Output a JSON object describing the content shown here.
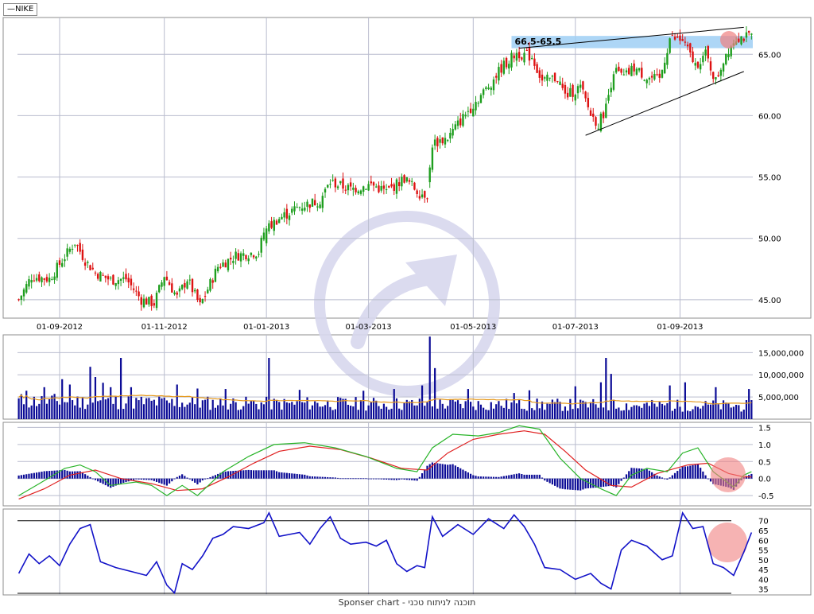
{
  "legend": {
    "symbol": "NIKE"
  },
  "footer": {
    "text": "Sponser chart - תוכנה לניתוח טכני"
  },
  "colors": {
    "up": "#1e9e1e",
    "down": "#dd1111",
    "volume": "#0b0b96",
    "volume_ma": "#e69a1e",
    "macd_fast": "#28b428",
    "macd_signal": "#e02020",
    "rsi": "#1212c8",
    "zone": "#9fcff5",
    "highlight": "#f08080",
    "grid": "#b9bcce",
    "watermark": "#d8d8ee"
  },
  "chart_data": {
    "type": "candlestick",
    "price": {
      "ylim": [
        43.5,
        68
      ],
      "ticks": [
        "45.00",
        "50.00",
        "55.00",
        "60.00",
        "65.00"
      ],
      "tick_values": [
        45,
        50,
        55,
        60,
        65
      ],
      "x_labels": [
        "01-09-2012",
        "01-11-2012",
        "01-01-2013",
        "01-03-2013",
        "01-05-2013",
        "01-07-2013",
        "01-09-2013"
      ],
      "x_label_index": [
        16,
        57,
        97,
        137,
        178,
        218,
        259
      ],
      "anchors": [
        [
          0,
          45.0
        ],
        [
          5,
          46.9
        ],
        [
          12,
          46.7
        ],
        [
          18,
          48.5
        ],
        [
          22,
          49.7
        ],
        [
          26,
          48.2
        ],
        [
          30,
          47.2
        ],
        [
          36,
          46.6
        ],
        [
          42,
          46.7
        ],
        [
          48,
          45.0
        ],
        [
          53,
          44.7
        ],
        [
          57,
          47.0
        ],
        [
          62,
          45.2
        ],
        [
          66,
          46.7
        ],
        [
          71,
          44.5
        ],
        [
          78,
          47.7
        ],
        [
          85,
          48.6
        ],
        [
          94,
          48.9
        ],
        [
          96,
          50.5
        ],
        [
          101,
          51.5
        ],
        [
          110,
          52.6
        ],
        [
          118,
          53.1
        ],
        [
          122,
          54.6
        ],
        [
          130,
          54.0
        ],
        [
          138,
          54.4
        ],
        [
          144,
          53.8
        ],
        [
          151,
          54.9
        ],
        [
          157,
          53.7
        ],
        [
          160,
          53.6
        ],
        [
          162,
          57.7
        ],
        [
          168,
          58.2
        ],
        [
          176,
          60.4
        ],
        [
          184,
          62.4
        ],
        [
          189,
          63.9
        ],
        [
          195,
          65.1
        ],
        [
          201,
          64.8
        ],
        [
          205,
          62.8
        ],
        [
          211,
          63.1
        ],
        [
          214,
          61.6
        ],
        [
          220,
          62.3
        ],
        [
          224,
          60.1
        ],
        [
          227,
          59.3
        ],
        [
          230,
          60.7
        ],
        [
          233,
          63.7
        ],
        [
          237,
          63.1
        ],
        [
          241,
          63.9
        ],
        [
          246,
          63.1
        ],
        [
          251,
          62.9
        ],
        [
          255,
          66.3
        ],
        [
          260,
          66.1
        ],
        [
          265,
          64.1
        ],
        [
          269,
          65.0
        ],
        [
          273,
          62.8
        ],
        [
          277,
          65.1
        ],
        [
          281,
          66.4
        ]
      ],
      "zone": {
        "label": "66.5-65.5",
        "low": 65.5,
        "high": 66.5
      },
      "trendlines": [
        {
          "from": [
            196,
            65.5
          ],
          "to": [
            284,
            67.2
          ]
        },
        {
          "from": [
            222,
            58.4
          ],
          "to": [
            284,
            63.6
          ]
        }
      ]
    },
    "volume": {
      "ylim": [
        0,
        19000000
      ],
      "ticks": [
        "5,000,000",
        "10,000,000",
        "15,000,000"
      ],
      "tick_values": [
        5000000,
        10000000,
        15000000
      ],
      "spikes": [
        [
          3,
          6400000
        ],
        [
          10,
          7200000
        ],
        [
          17,
          9000000
        ],
        [
          20,
          7800000
        ],
        [
          28,
          11800000
        ],
        [
          30,
          9500000
        ],
        [
          33,
          8200000
        ],
        [
          36,
          7200000
        ],
        [
          40,
          13800000
        ],
        [
          44,
          7200000
        ],
        [
          62,
          7800000
        ],
        [
          70,
          6900000
        ],
        [
          81,
          6800000
        ],
        [
          98,
          13800000
        ],
        [
          110,
          6600000
        ],
        [
          135,
          6400000
        ],
        [
          147,
          6800000
        ],
        [
          158,
          7600000
        ],
        [
          161,
          18600000
        ],
        [
          163,
          11500000
        ],
        [
          176,
          6800000
        ],
        [
          194,
          5900000
        ],
        [
          200,
          6500000
        ],
        [
          218,
          7400000
        ],
        [
          228,
          8300000
        ],
        [
          230,
          13800000
        ],
        [
          232,
          10200000
        ],
        [
          255,
          7600000
        ],
        [
          261,
          8300000
        ],
        [
          273,
          7200000
        ],
        [
          286,
          6800000
        ]
      ]
    },
    "macd": {
      "ylim": [
        -0.8,
        1.65
      ],
      "ticks": [
        "-0.5",
        "0.0",
        "0.5",
        "1.0",
        "1.5"
      ],
      "tick_values": [
        -0.5,
        0,
        0.5,
        1.0,
        1.5
      ],
      "fast": [
        [
          0,
          -0.5
        ],
        [
          8,
          -0.15
        ],
        [
          18,
          0.3
        ],
        [
          24,
          0.4
        ],
        [
          30,
          0.2
        ],
        [
          36,
          -0.2
        ],
        [
          46,
          -0.1
        ],
        [
          52,
          -0.2
        ],
        [
          58,
          -0.5
        ],
        [
          64,
          -0.2
        ],
        [
          70,
          -0.5
        ],
        [
          80,
          0.2
        ],
        [
          90,
          0.65
        ],
        [
          100,
          1.0
        ],
        [
          112,
          1.05
        ],
        [
          124,
          0.9
        ],
        [
          136,
          0.65
        ],
        [
          148,
          0.3
        ],
        [
          156,
          0.2
        ],
        [
          162,
          0.9
        ],
        [
          170,
          1.3
        ],
        [
          180,
          1.25
        ],
        [
          188,
          1.35
        ],
        [
          196,
          1.55
        ],
        [
          204,
          1.45
        ],
        [
          212,
          0.6
        ],
        [
          220,
          0.0
        ],
        [
          228,
          -0.3
        ],
        [
          234,
          -0.5
        ],
        [
          240,
          0.1
        ],
        [
          246,
          0.3
        ],
        [
          254,
          0.2
        ],
        [
          260,
          0.75
        ],
        [
          266,
          0.9
        ],
        [
          272,
          0.2
        ],
        [
          280,
          -0.25
        ],
        [
          284,
          0.1
        ],
        [
          287,
          0.2
        ]
      ],
      "signal": [
        [
          0,
          -0.6
        ],
        [
          10,
          -0.3
        ],
        [
          20,
          0.1
        ],
        [
          30,
          0.25
        ],
        [
          40,
          0.0
        ],
        [
          52,
          -0.15
        ],
        [
          62,
          -0.35
        ],
        [
          72,
          -0.3
        ],
        [
          82,
          0.05
        ],
        [
          92,
          0.45
        ],
        [
          102,
          0.8
        ],
        [
          114,
          0.95
        ],
        [
          126,
          0.85
        ],
        [
          138,
          0.6
        ],
        [
          150,
          0.3
        ],
        [
          160,
          0.25
        ],
        [
          168,
          0.75
        ],
        [
          178,
          1.15
        ],
        [
          188,
          1.3
        ],
        [
          198,
          1.4
        ],
        [
          206,
          1.3
        ],
        [
          214,
          0.8
        ],
        [
          222,
          0.25
        ],
        [
          232,
          -0.2
        ],
        [
          240,
          -0.25
        ],
        [
          250,
          0.15
        ],
        [
          262,
          0.4
        ],
        [
          270,
          0.45
        ],
        [
          278,
          0.15
        ],
        [
          284,
          0.05
        ],
        [
          287,
          0.05
        ]
      ]
    },
    "rsi": {
      "ylim": [
        32,
        76
      ],
      "ticks": [
        "35",
        "40",
        "45",
        "50",
        "55",
        "60",
        "65",
        "70"
      ],
      "tick_values": [
        35,
        40,
        45,
        50,
        55,
        60,
        65,
        70
      ],
      "levels": [
        70,
        30
      ],
      "values": [
        [
          0,
          43
        ],
        [
          4,
          53
        ],
        [
          8,
          48
        ],
        [
          12,
          52
        ],
        [
          16,
          47
        ],
        [
          20,
          58
        ],
        [
          24,
          66
        ],
        [
          28,
          68
        ],
        [
          32,
          49
        ],
        [
          38,
          46
        ],
        [
          44,
          44
        ],
        [
          50,
          42
        ],
        [
          54,
          49
        ],
        [
          58,
          37
        ],
        [
          61,
          33
        ],
        [
          64,
          48
        ],
        [
          68,
          45
        ],
        [
          72,
          52
        ],
        [
          76,
          61
        ],
        [
          80,
          63
        ],
        [
          84,
          67
        ],
        [
          90,
          66
        ],
        [
          96,
          69
        ],
        [
          98,
          74
        ],
        [
          102,
          62
        ],
        [
          110,
          64
        ],
        [
          114,
          58
        ],
        [
          118,
          66
        ],
        [
          122,
          72
        ],
        [
          126,
          61
        ],
        [
          130,
          58
        ],
        [
          136,
          59
        ],
        [
          140,
          57
        ],
        [
          144,
          60
        ],
        [
          148,
          48
        ],
        [
          152,
          44
        ],
        [
          156,
          47
        ],
        [
          159,
          46
        ],
        [
          162,
          72
        ],
        [
          166,
          62
        ],
        [
          172,
          68
        ],
        [
          178,
          63
        ],
        [
          184,
          71
        ],
        [
          190,
          66
        ],
        [
          194,
          73
        ],
        [
          198,
          67
        ],
        [
          202,
          58
        ],
        [
          206,
          46
        ],
        [
          212,
          45
        ],
        [
          218,
          40
        ],
        [
          224,
          43
        ],
        [
          228,
          38
        ],
        [
          232,
          35
        ],
        [
          236,
          55
        ],
        [
          240,
          60
        ],
        [
          246,
          57
        ],
        [
          252,
          50
        ],
        [
          256,
          52
        ],
        [
          260,
          74
        ],
        [
          264,
          66
        ],
        [
          268,
          67
        ],
        [
          272,
          48
        ],
        [
          276,
          46
        ],
        [
          278,
          44
        ],
        [
          280,
          42
        ],
        [
          284,
          54
        ],
        [
          287,
          64
        ]
      ]
    }
  }
}
